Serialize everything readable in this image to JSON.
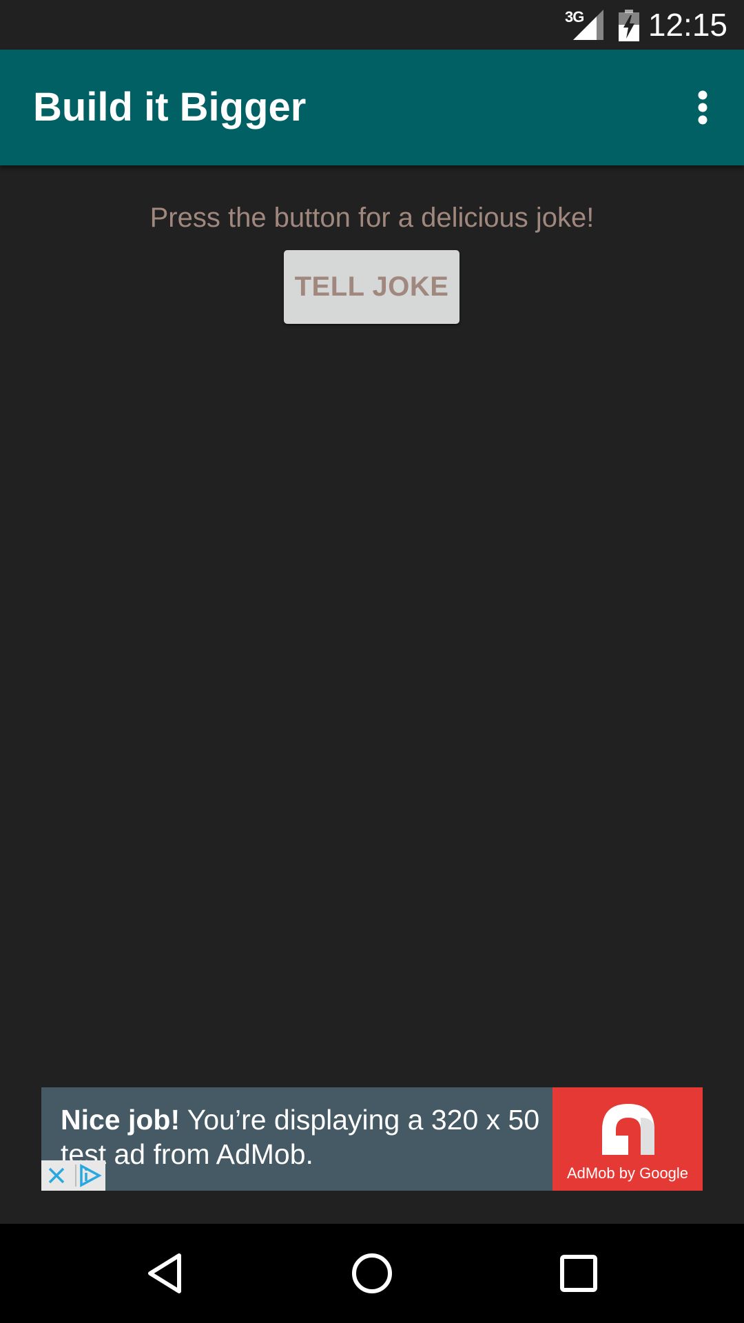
{
  "status_bar": {
    "network": "3G",
    "time": "12:15"
  },
  "app_bar": {
    "title": "Build it Bigger"
  },
  "main": {
    "prompt": "Press the button for a delicious joke!",
    "button_label": "TELL JOKE"
  },
  "ad": {
    "headline_bold": "Nice job!",
    "headline_rest": " You’re displaying a 320 x 50 test ad from AdMob.",
    "logo_caption": "AdMob by Google"
  },
  "colors": {
    "background": "#212121",
    "app_bar": "#016064",
    "accent_text": "#a1887f",
    "button_bg": "#d6d7d7",
    "ad_bg": "#455a64",
    "ad_logo_bg": "#e53935"
  },
  "icons": {
    "overflow": "more-vert-icon",
    "signal": "signal-icon",
    "battery": "battery-charging-icon",
    "back": "back-icon",
    "home": "home-icon",
    "recents": "recents-icon",
    "ad_close": "close-icon",
    "ad_choices": "ad-choices-icon"
  }
}
